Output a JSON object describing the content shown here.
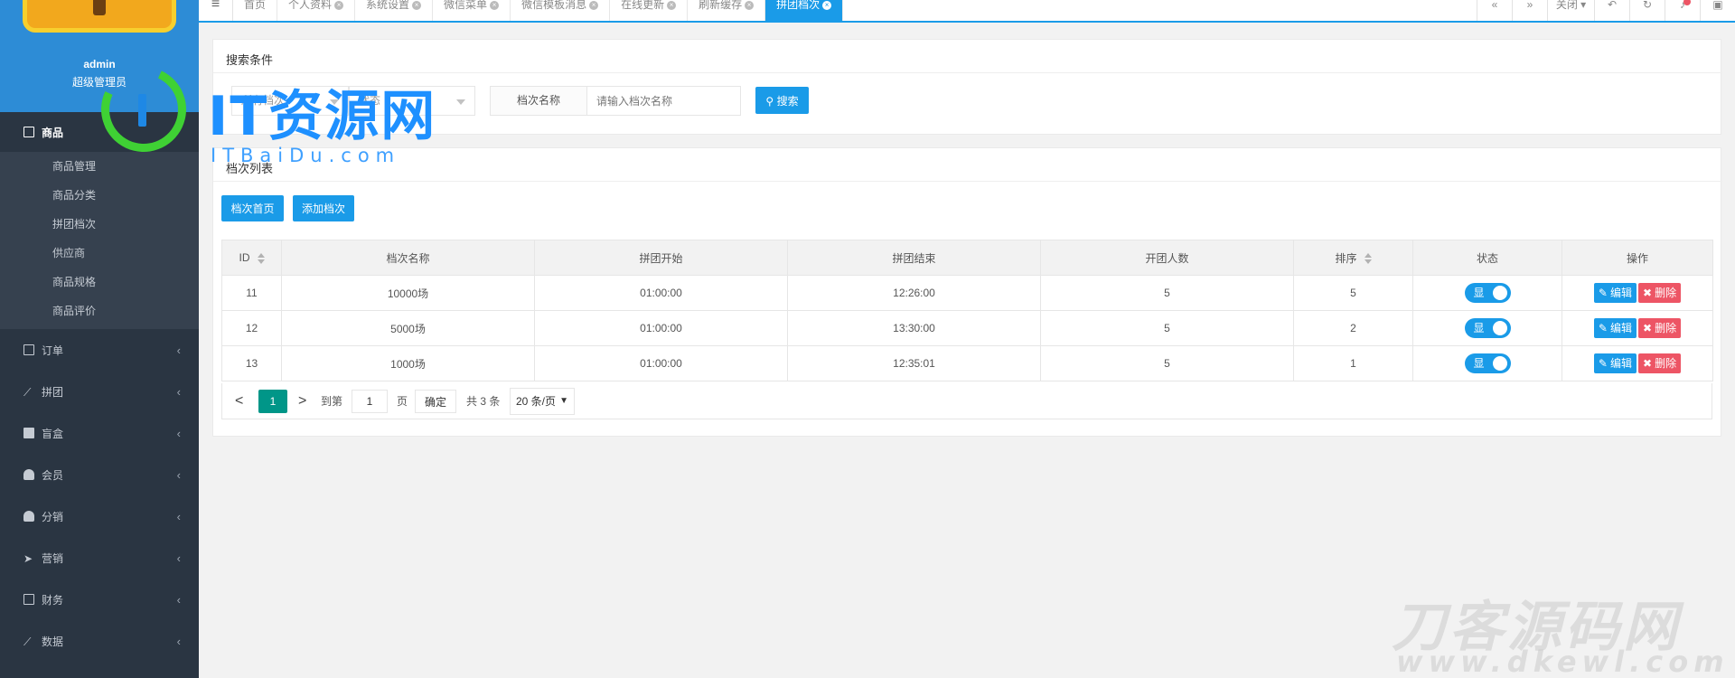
{
  "colors": {
    "accent": "#1a9be8",
    "sidebar": "#2a3542",
    "page_current": "#009688",
    "danger": "#ed5565"
  },
  "profile": {
    "name": "admin",
    "role": "超级管理员"
  },
  "sidebar": {
    "active": {
      "label": "商品",
      "icon": "laptop-icon"
    },
    "subitems": [
      "商品管理",
      "商品分类",
      "拼团档次",
      "供应商",
      "商品规格",
      "商品评价"
    ],
    "items": [
      {
        "label": "订单",
        "icon": "file-icon"
      },
      {
        "label": "拼团",
        "icon": "chart-icon"
      },
      {
        "label": "盲盒",
        "icon": "square-icon"
      },
      {
        "label": "会员",
        "icon": "user-icon"
      },
      {
        "label": "分销",
        "icon": "users-icon"
      },
      {
        "label": "营销",
        "icon": "send-icon"
      },
      {
        "label": "财务",
        "icon": "money-icon"
      },
      {
        "label": "数据",
        "icon": "chart-icon"
      }
    ]
  },
  "topbar": {
    "tabs": [
      "首页",
      "个人资料",
      "系统设置",
      "微信菜单",
      "微信模板消息",
      "在线更新",
      "刷新缓存",
      "拼团档次"
    ],
    "close_label": "关闭"
  },
  "search": {
    "title": "搜索条件",
    "select1": "所有档次",
    "select2": "状态",
    "field_label": "档次名称",
    "placeholder": "请输入档次名称",
    "button": "搜索"
  },
  "list": {
    "title": "档次列表",
    "home_button": "档次首页",
    "add_button": "添加档次",
    "columns": [
      "ID",
      "档次名称",
      "拼团开始",
      "拼团结束",
      "开团人数",
      "排序",
      "状态",
      "操作"
    ],
    "rows": [
      {
        "id": "11",
        "name": "10000场",
        "start": "01:00:00",
        "end": "12:26:00",
        "people": "5",
        "sort": "5",
        "status": "显"
      },
      {
        "id": "12",
        "name": "5000场",
        "start": "01:00:00",
        "end": "13:30:00",
        "people": "5",
        "sort": "2",
        "status": "显"
      },
      {
        "id": "13",
        "name": "1000场",
        "start": "01:00:00",
        "end": "12:35:01",
        "people": "5",
        "sort": "1",
        "status": "显"
      }
    ],
    "edit_label": "编辑",
    "delete_label": "删除"
  },
  "pager": {
    "prev": "<",
    "current": "1",
    "next": ">",
    "goto_label": "到第",
    "page_value": "1",
    "page_unit": "页",
    "confirm": "确定",
    "total": "共 3 条",
    "page_size": "20 条/页"
  },
  "watermarks": {
    "logo_main": "IT资源网",
    "logo_sub": "ITBaiDu.com",
    "corner_main": "刀客源码网",
    "corner_sub": "www.dkewl.com"
  }
}
